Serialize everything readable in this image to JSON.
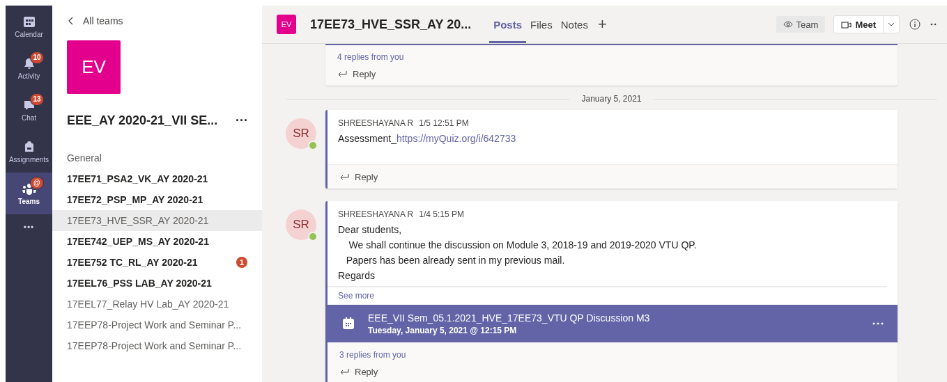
{
  "rail": {
    "items": [
      {
        "kind": "calendar",
        "label": "Calendar",
        "selected": false
      },
      {
        "kind": "bell",
        "label": "Activity",
        "badge": "10",
        "selected": false
      },
      {
        "kind": "chat",
        "label": "Chat",
        "badge": "13",
        "selected": false
      },
      {
        "kind": "bag",
        "label": "Assignments",
        "selected": false
      },
      {
        "kind": "teams",
        "label": "Teams",
        "badge": "@",
        "selected": true
      }
    ],
    "more": "•••"
  },
  "team_panel": {
    "back": "All teams",
    "avatar": "EV",
    "name": "EEE_AY 2020-21_VII SE...",
    "more": "···",
    "channels": [
      {
        "name": "General",
        "bold": false,
        "selected": false
      },
      {
        "name": "17EE71_PSA2_VK_AY 2020-21",
        "bold": true,
        "selected": false
      },
      {
        "name": "17EE72_PSP_MP_AY 2020-21",
        "bold": true,
        "selected": false
      },
      {
        "name": "17EE73_HVE_SSR_AY 2020-21",
        "bold": false,
        "selected": true
      },
      {
        "name": "17EE742_UEP_MS_AY 2020-21",
        "bold": true,
        "selected": false
      },
      {
        "name": "17EE752 TC_RL_AY 2020-21",
        "bold": true,
        "selected": false,
        "badge": "1"
      },
      {
        "name": "17EEL76_PSS LAB_AY 2020-21",
        "bold": true,
        "selected": false
      },
      {
        "name": "17EEL77_Relay HV Lab_AY 2020-21",
        "bold": false,
        "selected": false
      },
      {
        "name": "17EEP78-Project Work and Seminar P...",
        "bold": false,
        "selected": false
      },
      {
        "name": "17EEP78-Project Work and Seminar P...",
        "bold": false,
        "selected": false
      }
    ]
  },
  "header": {
    "avatar": "EV",
    "title": "17EE73_HVE_SSR_AY 20...",
    "tabs": [
      {
        "label": "Posts",
        "selected": true
      },
      {
        "label": "Files",
        "selected": false
      },
      {
        "label": "Notes",
        "selected": false
      }
    ],
    "add": "+",
    "team_button": "Team",
    "meet_button": "Meet"
  },
  "feed": {
    "top_card": {
      "replies": "4 replies from you",
      "reply": "Reply"
    },
    "date_divider": "January 5, 2021",
    "posts": [
      {
        "avatar": "SR",
        "online": true,
        "author": "SHREESHAYANA R",
        "time": "1/5 12:51 PM",
        "text": "Assessment_",
        "link": "https://myQuiz.org/i/642733",
        "reply": "Reply"
      },
      {
        "avatar": "SR",
        "online": true,
        "author": "SHREESHAYANA R",
        "time": "1/4 5:15 PM",
        "lines": [
          "Dear students,",
          "    We shall continue the discussion on Module 3, 2018-19 and 2019-2020 VTU QP.",
          "   Papers has been already sent in my previous mail.",
          "Regards"
        ],
        "see_more": "See more",
        "event": {
          "title": "EEE_VII Sem_05.1.2021_HVE_17EE73_VTU QP Discussion M3",
          "time": "Tuesday, January 5, 2021 @ 12:15 PM"
        },
        "replies": "3 replies from you",
        "reply": "Reply"
      }
    ]
  }
}
